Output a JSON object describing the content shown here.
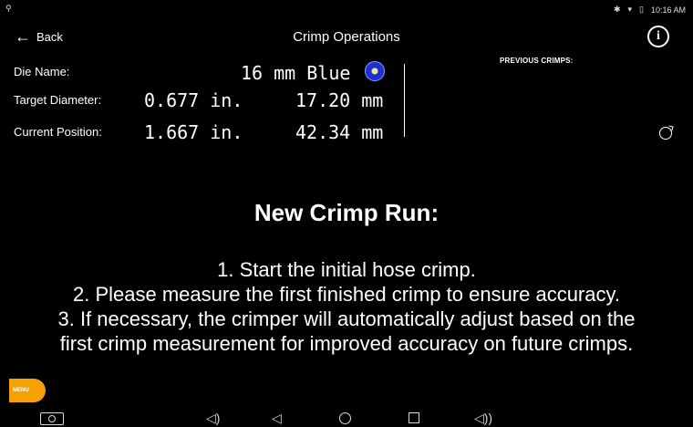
{
  "status_bar": {
    "left_icons": "⚲",
    "time": "10:16 AM"
  },
  "header": {
    "back_label": "Back",
    "title": "Crimp Operations"
  },
  "fields": {
    "die_name_label": "Die Name:",
    "die_name_value": "16 mm Blue",
    "target_diameter_label": "Target Diameter:",
    "target_in": "0.677 in.",
    "target_mm": "17.20 mm",
    "current_position_label": "Current Position:",
    "current_in": "1.667 in.",
    "current_mm": "42.34 mm"
  },
  "previous_crimps_label": "PREVIOUS CRIMPS:",
  "instructions": {
    "heading": "New Crimp Run:",
    "step1": "1. Start the initial hose crimp.",
    "step2": "2. Please measure the first finished crimp to ensure accuracy.",
    "step3": "3. If necessary, the crimper will automatically adjust based on the",
    "step4": "first crimp measurement for improved accuracy on future crimps."
  },
  "menu_label": "MENU",
  "colors": {
    "background": "#000000",
    "menu": "#f7a100",
    "die_color": "#1d2fd0"
  },
  "icons": {
    "info": "info-icon",
    "refresh": "refresh-icon",
    "back": "back-arrow-icon"
  }
}
